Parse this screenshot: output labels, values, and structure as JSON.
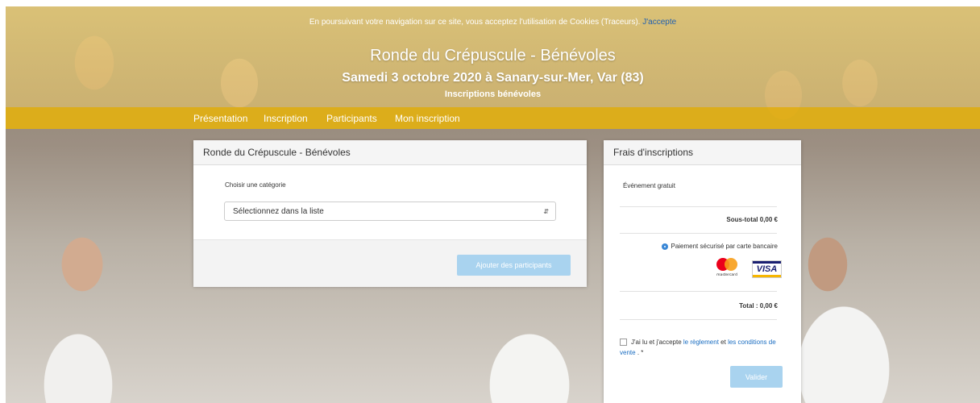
{
  "cookie_banner": {
    "message": "En poursuivant votre navigation sur ce site, vous acceptez l'utilisation de Cookies (Traceurs).",
    "accept_label": "J'accepte"
  },
  "header": {
    "title": "Ronde du Crépuscule - Bénévoles",
    "subtitle": "Samedi 3 octobre 2020 à Sanary-sur-Mer, Var (83)",
    "tagline": "Inscriptions bénévoles"
  },
  "nav": {
    "items": [
      {
        "label": "Présentation"
      },
      {
        "label": "Inscription"
      },
      {
        "label": "Participants"
      },
      {
        "label": "Mon inscription"
      }
    ]
  },
  "registration_panel": {
    "title": "Ronde du Crépuscule - Bénévoles",
    "category_label": "Choisir une catégorie",
    "category_select_value": "Sélectionnez dans la liste",
    "add_button_label": "Ajouter des participants"
  },
  "fees_panel": {
    "title": "Frais d'inscriptions",
    "event_status": "Événement gratuit",
    "subtotal": "Sous-total 0,00 €",
    "payment_option": "Paiement sécurisé par carte bancaire",
    "card_brands": [
      "mastercard",
      "VISA"
    ],
    "total": "Total : 0,00 €",
    "terms_prefix": "J'ai lu et j'accepte",
    "terms_link_rules": "le règlement",
    "terms_and": "et",
    "terms_link_conditions": "les conditions de vente",
    "terms_suffix": ". *",
    "submit_label": "Valider"
  },
  "colors": {
    "nav_bar": "#e2b012",
    "primary_button": "#a9d3ef",
    "link": "#1a6dc1",
    "mastercard_red": "#eb001b",
    "mastercard_orange": "#f79e1b",
    "visa_blue": "#1a1f71"
  }
}
